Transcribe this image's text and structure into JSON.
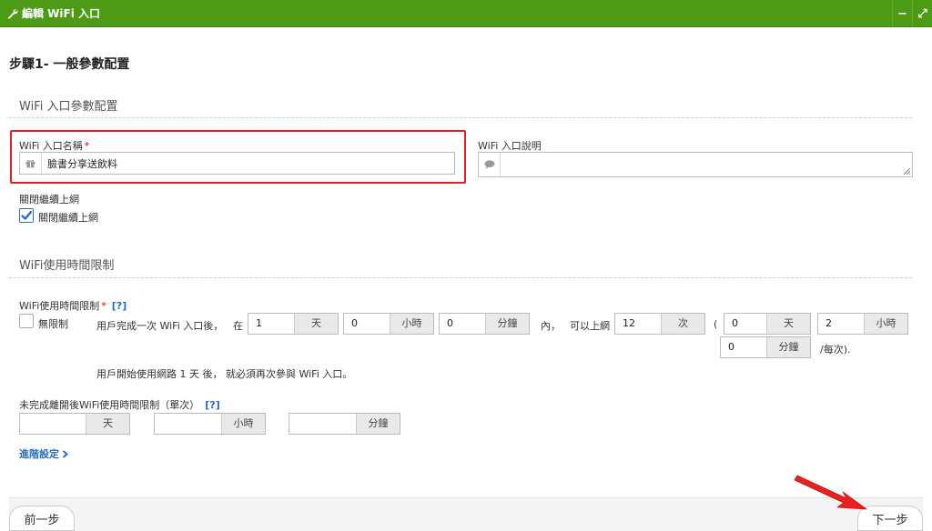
{
  "header": {
    "title": "編輯 WiFi 入口",
    "minimize": "−",
    "expand": "⤢"
  },
  "step_title": "步驟1- 一般參數配置",
  "section1": {
    "title": "WiFi 入口參數配置"
  },
  "portal_name": {
    "label": "WiFi 入口名稱",
    "required": "*",
    "value": "臉書分享送飲料"
  },
  "portal_desc": {
    "label": "WiFi 入口說明",
    "value": ""
  },
  "close_continue": {
    "label": "關閉繼續上網",
    "checkbox_label": "關閉繼續上網",
    "checked": true
  },
  "section2": {
    "title": "WiFi使用時間限制"
  },
  "time_limit": {
    "label": "WiFi使用時間限制",
    "required": "*",
    "help": "[?]",
    "unlimited_label": "無限制",
    "sentence_prefix": "用戶完成一次 WiFi 入口後，",
    "in_label": "在",
    "days": {
      "value": "1",
      "unit": "天"
    },
    "hours": {
      "value": "0",
      "unit": "小時"
    },
    "minutes": {
      "value": "0",
      "unit": "分鐘"
    },
    "inside_label": "內，",
    "can_connect_label": "可以上網",
    "times": {
      "value": "12",
      "unit": "次"
    },
    "open_paren": "(",
    "per_days": {
      "value": "0",
      "unit": "天"
    },
    "per_hours": {
      "value": "2",
      "unit": "小時"
    },
    "per_minutes": {
      "value": "0",
      "unit": "分鐘"
    },
    "per_suffix": "/每次).",
    "note": "用戶開始使用網路 1 天 後， 就必須再次參與 WiFi 入口。"
  },
  "incomplete_limit": {
    "label": "未完成離開後WiFi使用時間限制（單次）",
    "help": "[?]",
    "days": {
      "value": "",
      "unit": "天"
    },
    "hours": {
      "value": "",
      "unit": "小時"
    },
    "minutes": {
      "value": "",
      "unit": "分鐘"
    }
  },
  "advanced_link": "進階設定",
  "footer": {
    "prev": "前一步",
    "next": "下一步"
  },
  "colors": {
    "header_bg": "#4c9a16",
    "highlight": "#e41e1e",
    "link": "#2a6ebb",
    "arrow": "#e8201e"
  },
  "icons": {
    "header": "wrench-icon",
    "name_field": "gift-icon",
    "desc_field": "comment-icon",
    "link": "chevron-right-icon",
    "annotation": "red-arrow-icon"
  }
}
